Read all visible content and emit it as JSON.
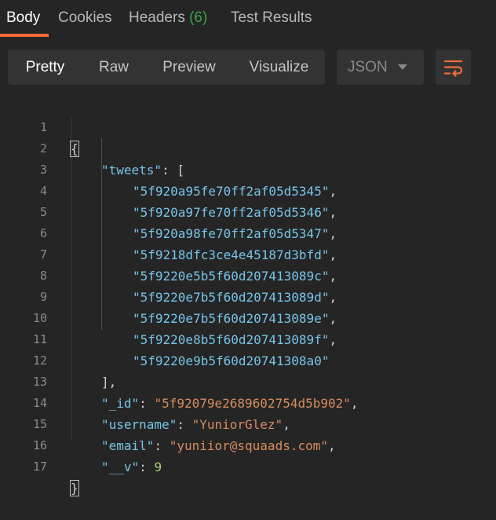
{
  "tabs": [
    {
      "label": "Body"
    },
    {
      "label": "Cookies"
    },
    {
      "label": "Headers",
      "count": "(6)"
    },
    {
      "label": "Test Results"
    }
  ],
  "view_modes": [
    "Pretty",
    "Raw",
    "Preview",
    "Visualize"
  ],
  "format_select": {
    "value": "JSON"
  },
  "colors": {
    "accent": "#f26b3a",
    "key": "#78c4e8",
    "string": "#d68d5d",
    "number": "#a9d36b",
    "badge": "#3fa34d"
  },
  "icons": {
    "wrap": "wrap-lines-icon",
    "dropdown": "chevron-down-icon"
  },
  "code": {
    "line_numbers": [
      "1",
      "2",
      "3",
      "4",
      "5",
      "6",
      "7",
      "8",
      "9",
      "10",
      "11",
      "12",
      "13",
      "14",
      "15",
      "16",
      "17"
    ],
    "lines": {
      "l1": "{",
      "l2_key": "\"tweets\"",
      "l2_rest": ": [",
      "tweets": [
        "\"5f920a95fe70ff2af05d5345\"",
        "\"5f920a97fe70ff2af05d5346\"",
        "\"5f920a98fe70ff2af05d5347\"",
        "\"5f9218dfc3ce4e45187d3bfd\"",
        "\"5f9220e5b5f60d207413089c\"",
        "\"5f9220e7b5f60d207413089d\"",
        "\"5f9220e7b5f60d207413089e\"",
        "\"5f9220e8b5f60d207413089f\"",
        "\"5f9220e9b5f60d20741308a0\""
      ],
      "l12": "],",
      "id_key": "\"_id\"",
      "id_val": "\"5f92079e2689602754d5b902\"",
      "username_key": "\"username\"",
      "username_val": "\"YuniorGlez\"",
      "email_key": "\"email\"",
      "email_val": "\"yuniior@squaads.com\"",
      "v_key": "\"__v\"",
      "v_val": "9",
      "l17": "}"
    }
  }
}
